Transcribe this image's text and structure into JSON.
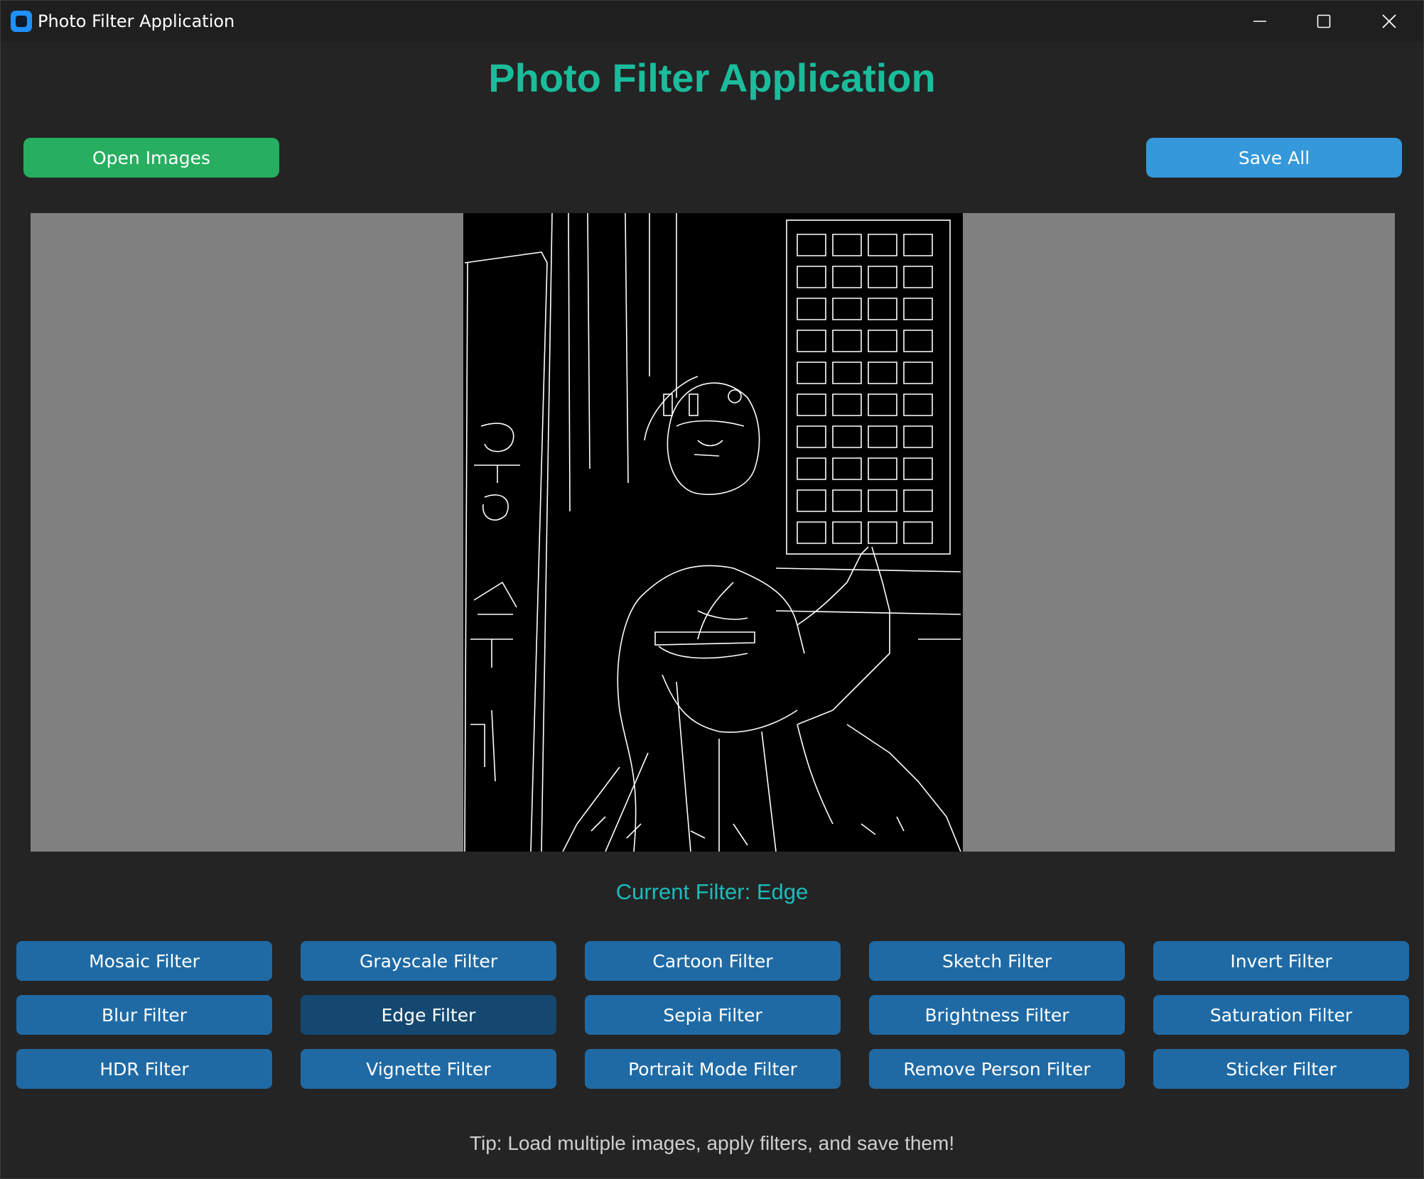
{
  "window": {
    "title": "Photo Filter Application",
    "icon": "app-logo-icon",
    "controls": [
      "minimize-icon",
      "maximize-icon",
      "close-icon"
    ]
  },
  "header": {
    "title": "Photo Filter Application"
  },
  "toolbar": {
    "open_label": "Open Images",
    "save_label": "Save All"
  },
  "preview": {
    "description_icon": "edge-filtered-photo"
  },
  "status": {
    "current_filter": "Current Filter: Edge"
  },
  "filters": [
    {
      "label": "Mosaic Filter",
      "active": false
    },
    {
      "label": "Grayscale Filter",
      "active": false
    },
    {
      "label": "Cartoon Filter",
      "active": false
    },
    {
      "label": "Sketch Filter",
      "active": false
    },
    {
      "label": "Invert Filter",
      "active": false
    },
    {
      "label": "Blur Filter",
      "active": false
    },
    {
      "label": "Edge Filter",
      "active": true
    },
    {
      "label": "Sepia Filter",
      "active": false
    },
    {
      "label": "Brightness Filter",
      "active": false
    },
    {
      "label": "Saturation Filter",
      "active": false
    },
    {
      "label": "HDR Filter",
      "active": false
    },
    {
      "label": "Vignette Filter",
      "active": false
    },
    {
      "label": "Portrait Mode Filter",
      "active": false
    },
    {
      "label": "Remove Person Filter",
      "active": false
    },
    {
      "label": "Sticker Filter",
      "active": false
    }
  ],
  "footer": {
    "tip": "Tip: Load multiple images, apply filters, and save them!"
  },
  "colors": {
    "heading": "#1abc9c",
    "open_button": "#27ae60",
    "save_button": "#3498db",
    "filter_button": "#1f6aa5",
    "filter_button_active": "#144870",
    "status_text": "#1abcbc"
  }
}
